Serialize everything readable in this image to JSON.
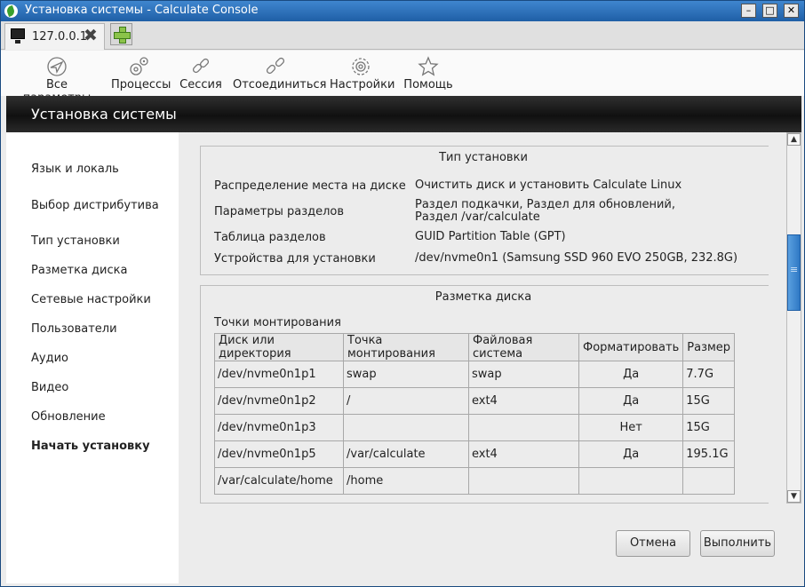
{
  "window": {
    "title": "Установка системы - Calculate Console",
    "controls": {
      "minimize": "–",
      "maximize": "□",
      "close": "✕"
    }
  },
  "tabs": [
    {
      "label": "127.0.0.1",
      "close": "✖"
    }
  ],
  "toolbar": [
    {
      "label": "Все параметры",
      "icon": "compass-icon"
    },
    {
      "label": "Процессы",
      "icon": "processes-icon"
    },
    {
      "label": "Сессия",
      "icon": "link-icon"
    },
    {
      "label": "Отсоединиться",
      "icon": "unlink-icon"
    },
    {
      "label": "Настройки",
      "icon": "settings-icon"
    },
    {
      "label": "Помощь",
      "icon": "star-icon"
    }
  ],
  "header": {
    "title": "Установка системы"
  },
  "sidebar": {
    "items": [
      {
        "label": "Язык и локаль"
      },
      {
        "label": "Выбор дистрибутива"
      },
      {
        "label": "Тип установки"
      },
      {
        "label": "Разметка диска"
      },
      {
        "label": "Сетевые настройки"
      },
      {
        "label": "Пользователи"
      },
      {
        "label": "Аудио"
      },
      {
        "label": "Видео"
      },
      {
        "label": "Обновление"
      },
      {
        "label": "Начать установку",
        "active": true
      }
    ]
  },
  "install_type": {
    "title": "Тип установки",
    "rows": [
      {
        "key": "Распределение места на диске",
        "value": "Очистить диск и установить Calculate Linux"
      },
      {
        "key": "Параметры разделов",
        "value": "Раздел подкачки, Раздел для обновлений, Раздел /var/calculate"
      },
      {
        "key": "Таблица разделов",
        "value": "GUID Partition Table (GPT)"
      },
      {
        "key": "Устройства для установки",
        "value": "/dev/nvme0n1 (Samsung SSD 960 EVO 250GB, 232.8G)"
      }
    ]
  },
  "disk_layout": {
    "title": "Разметка диска",
    "mount_label": "Точки монтирования",
    "columns": [
      "Диск или директория",
      "Точка монтирования",
      "Файловая система",
      "Форматировать",
      "Размер"
    ],
    "rows": [
      [
        "/dev/nvme0n1p1",
        "swap",
        "swap",
        "Да",
        "7.7G"
      ],
      [
        "/dev/nvme0n1p2",
        "/",
        "ext4",
        "Да",
        "15G"
      ],
      [
        "/dev/nvme0n1p3",
        "",
        "",
        "Нет",
        "15G"
      ],
      [
        "/dev/nvme0n1p5",
        "/var/calculate",
        "ext4",
        "Да",
        "195.1G"
      ],
      [
        "/var/calculate/home",
        "/home",
        "",
        "",
        ""
      ]
    ]
  },
  "actions": {
    "cancel": "Отмена",
    "execute": "Выполнить"
  },
  "scroll": {
    "position": 0.35
  }
}
